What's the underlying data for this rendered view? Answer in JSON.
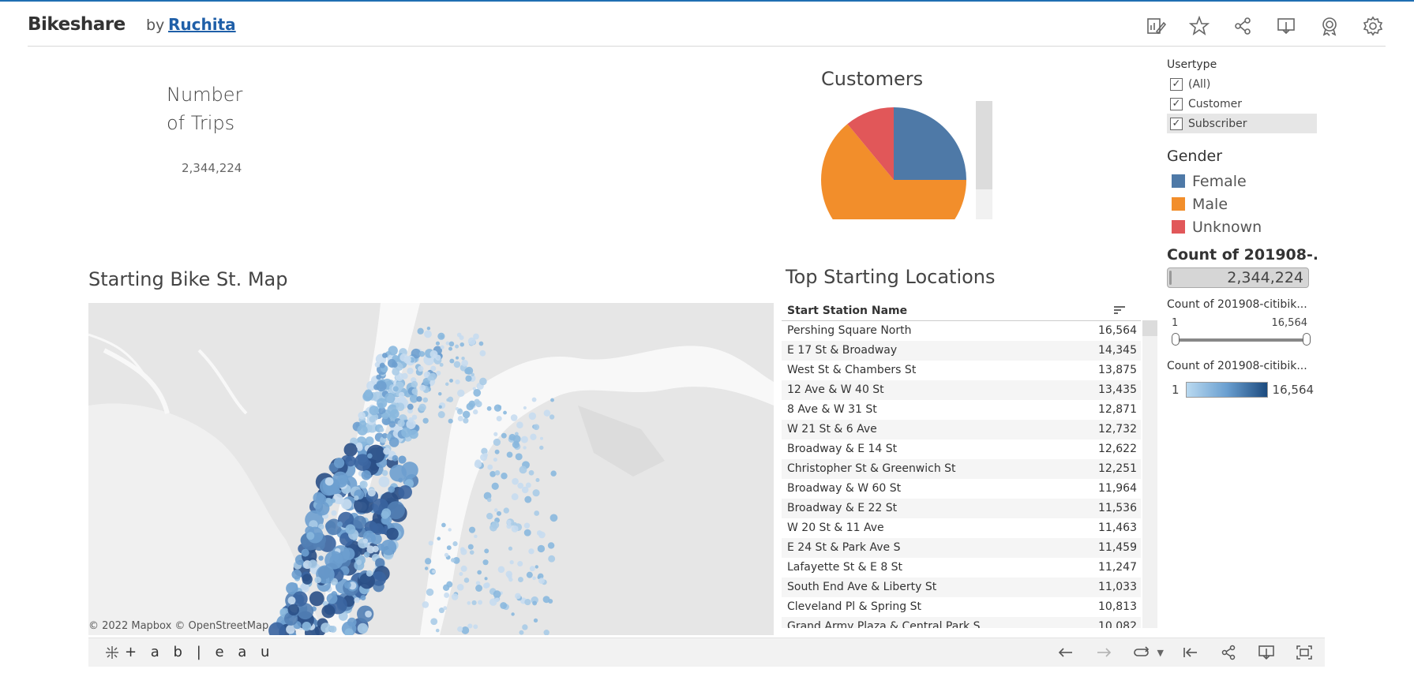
{
  "header": {
    "title": "Bikeshare",
    "by": "by",
    "author": "Ruchita",
    "icons": [
      "edit-icon",
      "favorite-icon",
      "share-icon",
      "download-icon",
      "metrics-icon",
      "settings-icon"
    ]
  },
  "kpi": {
    "title_line1": "Number",
    "title_line2": "of Trips",
    "value": "2,344,224"
  },
  "pie": {
    "title": "Customers"
  },
  "filters": {
    "usertype_label": "Usertype",
    "usertype_options": [
      {
        "label": "(All)",
        "checked": true
      },
      {
        "label": "Customer",
        "checked": true
      },
      {
        "label": "Subscriber",
        "checked": true
      }
    ],
    "gender_label": "Gender",
    "gender_legend": [
      {
        "label": "Female",
        "color": "#4e79a7"
      },
      {
        "label": "Male",
        "color": "#f28e2b"
      },
      {
        "label": "Unknown",
        "color": "#e15759"
      }
    ],
    "count_label": "Count of 201908-...",
    "count_value": "2,344,224",
    "range_label": "Count of 201908-citibik...",
    "range_min": "1",
    "range_max": "16,564",
    "color_label": "Count of 201908-citibik...",
    "color_min": "1",
    "color_max": "16,564"
  },
  "map": {
    "title": "Starting Bike St. Map",
    "attribution": "© 2022 Mapbox  © OpenStreetMap"
  },
  "table": {
    "title": "Top Starting Locations",
    "column_header": "Start Station Name",
    "rows": [
      {
        "name": "Pershing Square North",
        "value": "16,564"
      },
      {
        "name": "E 17 St & Broadway",
        "value": "14,345"
      },
      {
        "name": "West St & Chambers St",
        "value": "13,875"
      },
      {
        "name": "12 Ave & W 40 St",
        "value": "13,435"
      },
      {
        "name": "8 Ave & W 31 St",
        "value": "12,871"
      },
      {
        "name": "W 21 St & 6 Ave",
        "value": "12,732"
      },
      {
        "name": "Broadway & E 14 St",
        "value": "12,622"
      },
      {
        "name": "Christopher St & Greenwich St",
        "value": "12,251"
      },
      {
        "name": "Broadway & W 60 St",
        "value": "11,964"
      },
      {
        "name": "Broadway & E 22 St",
        "value": "11,536"
      },
      {
        "name": "W 20 St & 11 Ave",
        "value": "11,463"
      },
      {
        "name": "E 24 St & Park Ave S",
        "value": "11,459"
      },
      {
        "name": "Lafayette St & E 8 St",
        "value": "11,247"
      },
      {
        "name": "South End Ave & Liberty St",
        "value": "11,033"
      },
      {
        "name": "Cleveland Pl & Spring St",
        "value": "10,813"
      },
      {
        "name": "Grand Army Plaza & Central Park S",
        "value": "10,082"
      }
    ]
  },
  "footer": {
    "logo": "+ a b | e a u"
  },
  "chart_data": {
    "type": "pie",
    "title": "Customers",
    "series": [
      {
        "name": "Female",
        "value": 25,
        "color": "#4e79a7"
      },
      {
        "name": "Male",
        "value": 64,
        "color": "#f28e2b"
      },
      {
        "name": "Unknown",
        "value": 11,
        "color": "#e15759"
      }
    ]
  }
}
